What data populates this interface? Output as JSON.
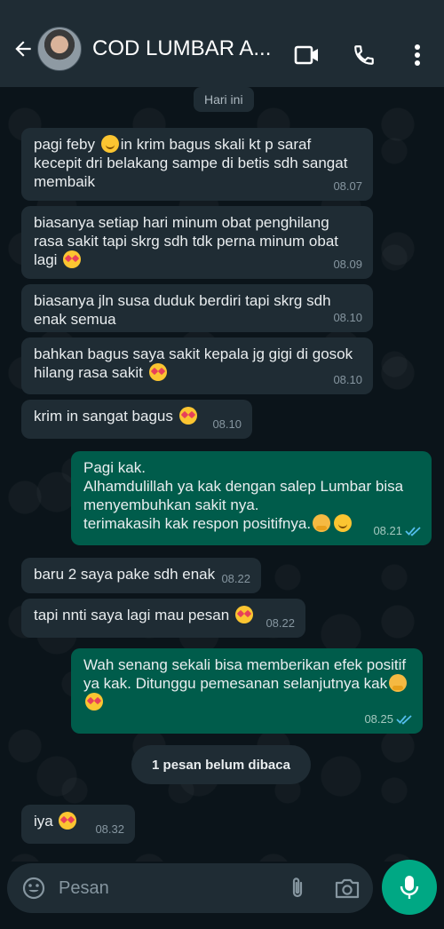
{
  "header": {
    "title": "COD LUMBAR A...",
    "back_icon": "arrow-left-icon",
    "video_icon": "video-camera-icon",
    "call_icon": "phone-icon",
    "menu_icon": "more-vertical-icon"
  },
  "date_chip": "Hari ini",
  "messages": [
    {
      "dir": "in",
      "text_a": "pagi feby ",
      "text_b": "in krim bagus skali kt p saraf kecepit dri belakang sampe di betis sdh sangat membaik",
      "time": "08.07"
    },
    {
      "dir": "in",
      "text": "biasanya setiap hari minum obat penghilang rasa sakit tapi skrg sdh tdk perna minum obat lagi ",
      "time": "08.09"
    },
    {
      "dir": "in",
      "text": "biasanya jln susa duduk berdiri tapi skrg sdh enak semua",
      "time": "08.10"
    },
    {
      "dir": "in",
      "text": "bahkan bagus saya sakit kepala jg gigi di gosok hilang rasa sakit ",
      "time": "08.10"
    },
    {
      "dir": "in",
      "text": "krim in sangat bagus ",
      "time": "08.10"
    },
    {
      "dir": "out",
      "line1": "Pagi kak.",
      "line2": "Alhamdulillah ya kak dengan salep Lumbar bisa menyembuhkan sakit nya.",
      "line3": "terimakasih kak respon positifnya.",
      "time": "08.21"
    },
    {
      "dir": "in",
      "text": "baru 2 saya pake sdh enak",
      "time": "08.22"
    },
    {
      "dir": "in",
      "text": "tapi nnti saya lagi mau pesan ",
      "time": "08.22"
    },
    {
      "dir": "out",
      "text": "Wah senang sekali bisa memberikan efek positif ya kak. Ditunggu pemesanan selanjutnya kak",
      "time": "08.25"
    },
    {
      "dir": "in",
      "text": "iya ",
      "time": "08.32"
    }
  ],
  "unread_banner": "1 pesan belum dibaca",
  "input": {
    "placeholder": "Pesan",
    "emoji_icon": "emoji-icon",
    "attach_icon": "paperclip-icon",
    "camera_icon": "camera-icon",
    "mic_icon": "microphone-icon"
  },
  "colors": {
    "incoming_bubble": "#1f2c34",
    "outgoing_bubble": "#005c4b",
    "accent": "#00a884",
    "read_tick": "#53bdeb"
  }
}
